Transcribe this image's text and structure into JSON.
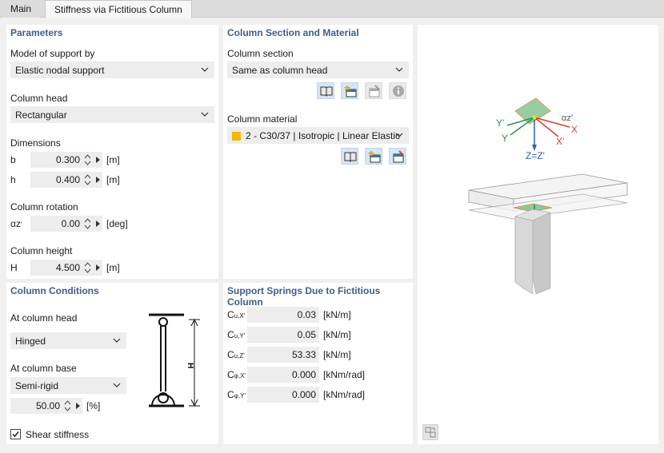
{
  "tabs": [
    {
      "label": "Main"
    },
    {
      "label": "Stiffness via Fictitious Column"
    }
  ],
  "parameters": {
    "title": "Parameters",
    "model_label": "Model of support by",
    "model_value": "Elastic nodal support",
    "column_head_label": "Column head",
    "column_head_value": "Rectangular",
    "dimensions_label": "Dimensions",
    "b_label": "b",
    "b_value": "0.300",
    "b_unit": "[m]",
    "h_label": "h",
    "h_value": "0.400",
    "h_unit": "[m]",
    "rotation_label": "Column rotation",
    "alpha_label": "αz",
    "alpha_sub": "'",
    "alpha_value": "0.00",
    "alpha_unit": "[deg]",
    "height_label": "Column height",
    "H_label": "H",
    "H_value": "4.500",
    "H_unit": "[m]"
  },
  "section": {
    "title": "Column Section and Material",
    "section_label": "Column section",
    "section_value": "Same as column head",
    "material_label": "Column material",
    "material_value": "2 - C30/37 | Isotropic | Linear Elastic",
    "material_color": "#f2b807"
  },
  "conditions": {
    "title": "Column Conditions",
    "head_label": "At column head",
    "head_value": "Hinged",
    "base_label": "At column base",
    "base_value": "Semi-rigid",
    "base_percent": "50.00",
    "base_percent_unit": "[%]",
    "shear_label": "Shear stiffness",
    "diagram_H": "H"
  },
  "springs": {
    "title": "Support Springs Due to Fictitious Column",
    "rows": [
      {
        "sym": "C",
        "sub": "u,X'",
        "value": "0.03",
        "unit": "[kN/m]"
      },
      {
        "sym": "C",
        "sub": "u,Y'",
        "value": "0.05",
        "unit": "[kN/m]"
      },
      {
        "sym": "C",
        "sub": "u,Z'",
        "value": "53.33",
        "unit": "[kN/m]"
      },
      {
        "sym": "C",
        "sub": "φ,X'",
        "value": "0.000",
        "unit": "[kNm/rad]"
      },
      {
        "sym": "C",
        "sub": "φ,Y'",
        "value": "0.000",
        "unit": "[kNm/rad]"
      }
    ]
  },
  "view": {
    "axis_y_prime": "Y'",
    "axis_y": "Y",
    "axis_x_prime": "X'",
    "axis_x": "X",
    "axis_z": "Z=Z'",
    "axis_alpha": "αz'",
    "colors": {
      "x_axis": "#e03c2a",
      "y_axis": "#1f9a53",
      "z_axis": "#2e5fb8",
      "plate": "#8dc89a"
    }
  }
}
